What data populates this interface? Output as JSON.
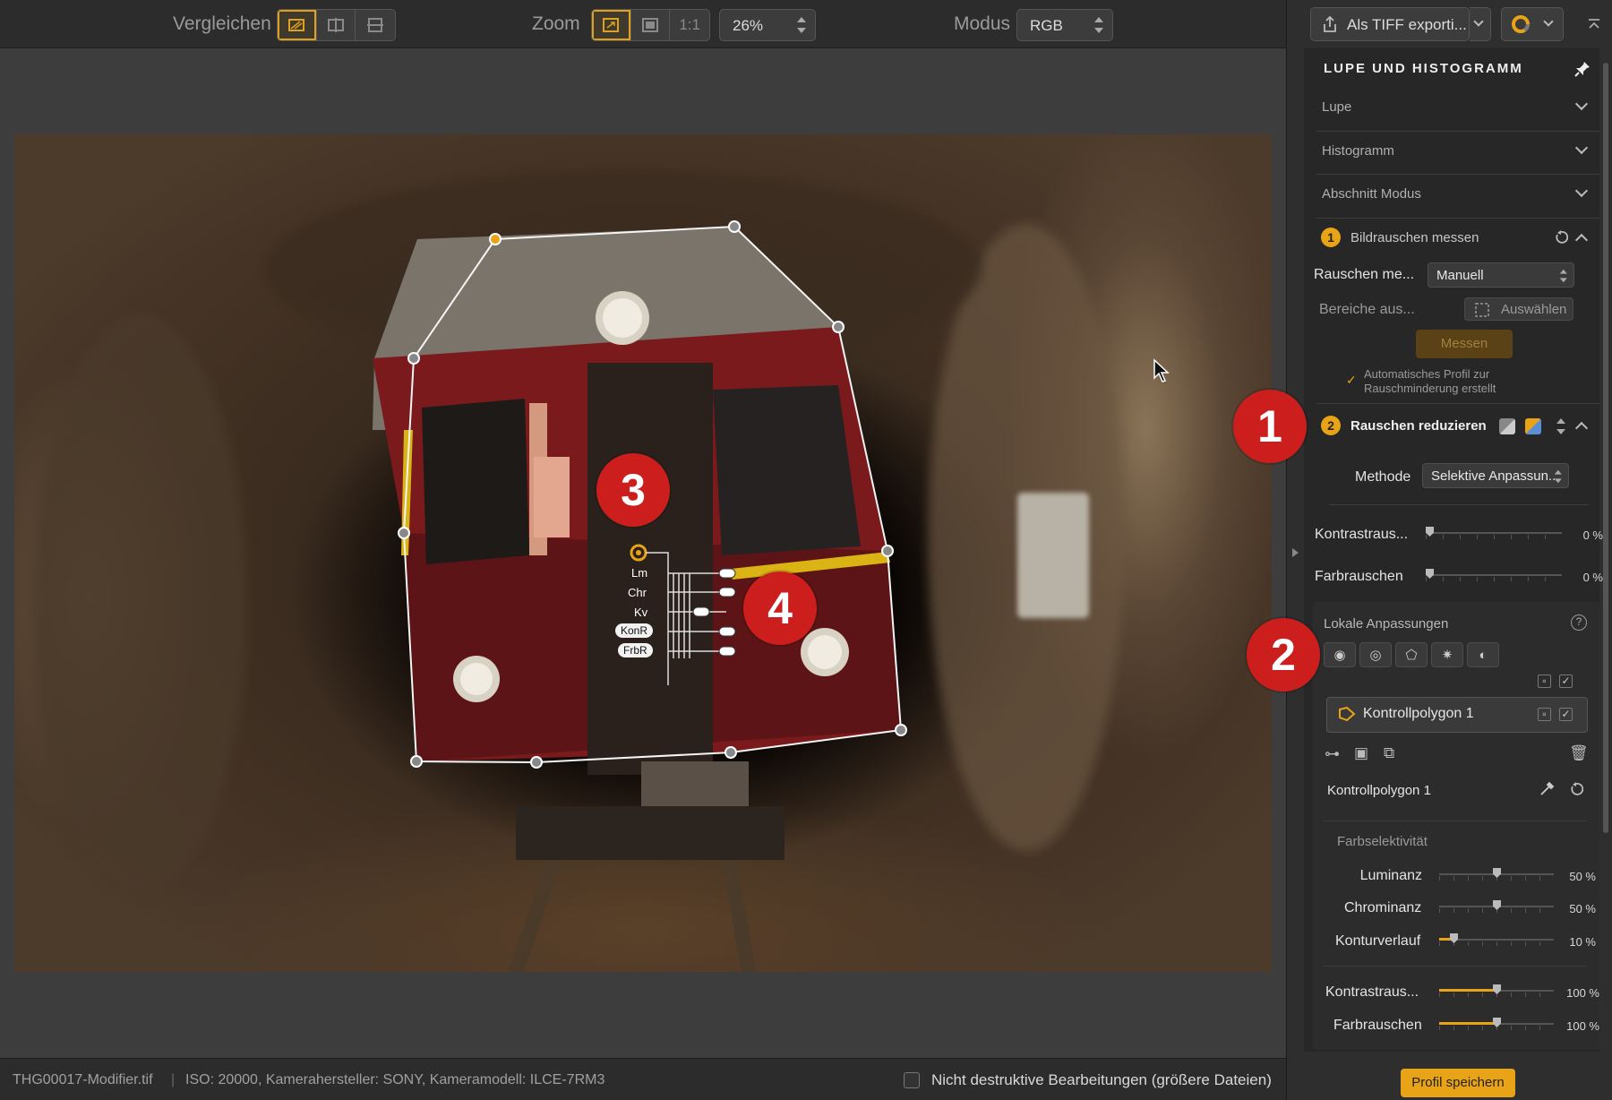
{
  "toolbar": {
    "compare_label": "Vergleichen",
    "zoom_label": "Zoom",
    "zoom_one_to_one": "1:1",
    "zoom_value": "26%",
    "mode_label": "Modus",
    "mode_value": "RGB",
    "export_label": "Als TIFF exporti..."
  },
  "canvas": {
    "overlay_labels": [
      "Lm",
      "Chr",
      "Kv",
      "KonR",
      "FrbR"
    ],
    "callouts": [
      "1",
      "2",
      "3",
      "4"
    ]
  },
  "statusbar": {
    "filename": "THG00017-Modifier.tif",
    "meta": "ISO: 20000, Kamerahersteller: SONY, Kameramodell: ILCE-7RM3",
    "nondestructive_label": "Nicht destruktive Bearbeitungen (größere Dateien)"
  },
  "panel": {
    "title": "LUPE UND HISTOGRAMM",
    "sections": [
      "Lupe",
      "Histogramm",
      "Abschnitt Modus"
    ],
    "step1": {
      "number": "1",
      "title": "Bildrauschen messen",
      "measure_label": "Rauschen me...",
      "measure_value": "Manuell",
      "areas_label": "Bereiche aus...",
      "select_button": "Auswählen",
      "measure_button": "Messen",
      "auto_profile_note": "Automatisches Profil zur Rauschminderung erstellt"
    },
    "step2": {
      "number": "2",
      "title": "Rauschen reduzieren",
      "method_label": "Methode",
      "method_value": "Selektive Anpassun...",
      "contrast_noise_label": "Kontrastraus...",
      "contrast_noise_value": "0 %",
      "color_noise_label": "Farbrauschen",
      "color_noise_value": "0 %"
    },
    "local": {
      "title": "Lokale Anpassungen",
      "help": "?",
      "item_name": "Kontrollpolygon 1",
      "item_detail_name": "Kontrollpolygon 1",
      "color_selectivity": "Farbselektivität",
      "luminance_label": "Luminanz",
      "luminance_value": "50 %",
      "luminance_level": 0.5,
      "chrominance_label": "Chrominanz",
      "chrominance_value": "50 %",
      "chrominance_level": 0.5,
      "contour_label": "Konturverlauf",
      "contour_value": "10 %",
      "contour_level": 0.1,
      "contrast_noise_label": "Kontrastraus...",
      "contrast_noise_value": "100 %",
      "contrast_noise_level": 1.0,
      "color_noise_label": "Farbrauschen",
      "color_noise_value": "100 %",
      "color_noise_level": 1.0
    },
    "save_profile_button": "Profil speichern"
  },
  "colors": {
    "accent": "#e8a316",
    "callout": "#cd1e1e",
    "panel_bg": "#272727",
    "toolbar_bg": "#2c2c2c"
  }
}
